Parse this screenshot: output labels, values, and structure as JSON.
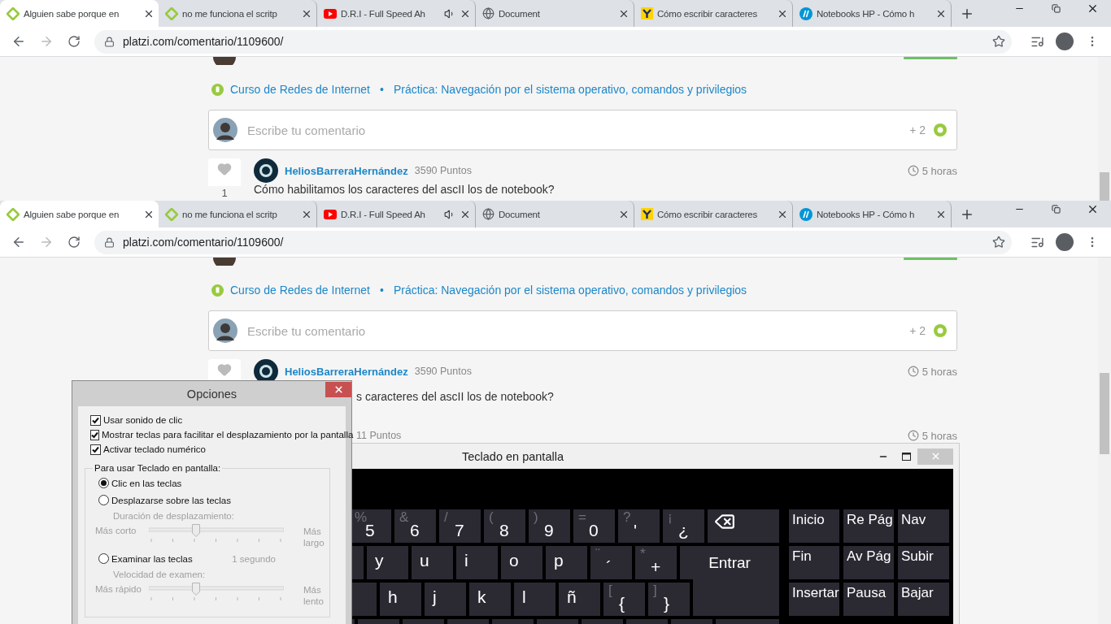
{
  "screens": [
    {
      "tabs": [
        {
          "title": "Alguien sabe porque en",
          "kind": "leaf",
          "selected": true,
          "audio": false
        },
        {
          "title": "no me funciona el scritp",
          "kind": "leaf",
          "selected": false,
          "audio": false
        },
        {
          "title": "D.R.I - Full Speed Ah",
          "kind": "video",
          "selected": false,
          "audio": true
        },
        {
          "title": "Document",
          "kind": "globe",
          "selected": false,
          "audio": false
        },
        {
          "title": "Cómo escribir caracteres",
          "kind": "square",
          "selected": false,
          "audio": false
        },
        {
          "title": "Notebooks HP - Cómo h",
          "kind": "circle",
          "selected": false,
          "audio": false
        }
      ],
      "url": "platzi.com/comentario/1109600/",
      "breadcrumb": {
        "course": "Curso de Redes de Internet",
        "separator": "•",
        "lesson": "Práctica: Navegación por el sistema operativo, comandos y privilegios"
      },
      "comment_box": {
        "placeholder": "Escribe tu comentario",
        "points": "+ 2"
      },
      "posts": [
        {
          "kind": "full",
          "likes": "1",
          "author": "HeliosBarreraHernández",
          "points": "3590 Puntos",
          "time": "5 horas",
          "body": "Cómo habilitamos los caracteres del ascII los de notebook?"
        }
      ]
    },
    {
      "tabs": [
        {
          "title": "Alguien sabe porque en",
          "kind": "leaf",
          "selected": true,
          "audio": false
        },
        {
          "title": "no me funciona el scritp",
          "kind": "leaf",
          "selected": false,
          "audio": false
        },
        {
          "title": "D.R.I - Full Speed Ah",
          "kind": "video",
          "selected": false,
          "audio": true
        },
        {
          "title": "Document",
          "kind": "globe",
          "selected": false,
          "audio": false
        },
        {
          "title": "Cómo escribir caracteres",
          "kind": "square",
          "selected": false,
          "audio": false
        },
        {
          "title": "Notebooks HP - Cómo h",
          "kind": "circle",
          "selected": false,
          "audio": false
        }
      ],
      "url": "platzi.com/comentario/1109600/",
      "breadcrumb": {
        "course": "Curso de Redes de Internet",
        "separator": "•",
        "lesson": "Práctica: Navegación por el sistema operativo, comandos y privilegios"
      },
      "comment_box": {
        "placeholder": "Escribe tu comentario",
        "points": "+ 2"
      },
      "posts": [
        {
          "kind": "partial",
          "author": "HeliosBarreraHernández",
          "points": "3590 Puntos",
          "time": "5 horas",
          "body": "s caracteres del ascII los de notebook?"
        },
        {
          "kind": "stub",
          "points": "11 Puntos",
          "time": "5 horas"
        }
      ]
    }
  ],
  "options": {
    "title": "Opciones",
    "checkboxes": [
      {
        "label": "Usar sonido de clic",
        "checked": true
      },
      {
        "label": "Mostrar teclas para facilitar el desplazamiento por la pantalla",
        "checked": true
      },
      {
        "label": "Activar teclado numérico",
        "checked": true
      }
    ],
    "group": {
      "label": "Para usar Teclado en pantalla:",
      "choices": [
        {
          "label": "Clic en las teclas",
          "selected": true
        },
        {
          "label": "Desplazarse sobre las teclas",
          "selected": false,
          "slider": {
            "label": "Duración de desplazamiento:",
            "min_label": "Más corto",
            "max_label": "Más largo",
            "level": 0.35,
            "disabled": true
          }
        },
        {
          "label": "Examinar las teclas",
          "selected": false,
          "value": "1 segundo",
          "slider": {
            "label": "Velocidad de examen:",
            "min_label": "Más rápido",
            "max_label": "Más lento",
            "level": 0.35,
            "disabled": true
          }
        }
      ]
    }
  },
  "keyboard": {
    "title": "Teclado en pantalla",
    "rows": [
      [
        {
          "kind": "symbol",
          "shift": "%",
          "label": "5"
        },
        {
          "kind": "symbol",
          "shift": "&",
          "label": "6"
        },
        {
          "kind": "symbol",
          "shift": "/",
          "label": "7"
        },
        {
          "kind": "symbol",
          "shift": "(",
          "label": "8"
        },
        {
          "kind": "symbol",
          "shift": ")",
          "label": "9"
        },
        {
          "kind": "symbol",
          "shift": "=",
          "label": "0"
        },
        {
          "kind": "symbol",
          "shift": "?",
          "label": "'"
        },
        {
          "kind": "symbol",
          "shift": "¡",
          "label": "¿"
        },
        {
          "kind": "backspace"
        }
      ],
      [
        {
          "kind": "blank"
        },
        {
          "kind": "letter",
          "label": "y"
        },
        {
          "kind": "letter",
          "label": "u"
        },
        {
          "kind": "letter",
          "label": "i"
        },
        {
          "kind": "letter",
          "label": "o"
        },
        {
          "kind": "letter",
          "label": "p"
        },
        {
          "kind": "symbol",
          "shift": "¨",
          "label": "´"
        },
        {
          "kind": "symbol",
          "shift": "*",
          "label": "+"
        },
        {
          "kind": "enter",
          "label": "Entrar"
        }
      ],
      [
        {
          "kind": "blank"
        },
        {
          "kind": "letter",
          "label": "h"
        },
        {
          "kind": "letter",
          "label": "j"
        },
        {
          "kind": "letter",
          "label": "k"
        },
        {
          "kind": "letter",
          "label": "l"
        },
        {
          "kind": "letter",
          "label": "ñ"
        },
        {
          "kind": "symbol",
          "shift": "[",
          "label": "{"
        },
        {
          "kind": "symbol",
          "shift": "]",
          "label": "}"
        },
        {
          "kind": "enter-tail"
        }
      ],
      [
        {
          "kind": "blank"
        },
        {
          "kind": "blank"
        },
        {
          "kind": "blank"
        },
        {
          "kind": "blank"
        },
        {
          "kind": "blank"
        },
        {
          "kind": "blank"
        },
        {
          "kind": "blank"
        },
        {
          "kind": "blank"
        },
        {
          "kind": "blank"
        },
        {
          "kind": "wide"
        }
      ]
    ],
    "nav": [
      [
        "Inicio",
        "Re Pág",
        "Nav"
      ],
      [
        "Fin",
        "Av Pág",
        "Subir"
      ],
      [
        "Insertar",
        "Pausa",
        "Bajar"
      ]
    ]
  }
}
